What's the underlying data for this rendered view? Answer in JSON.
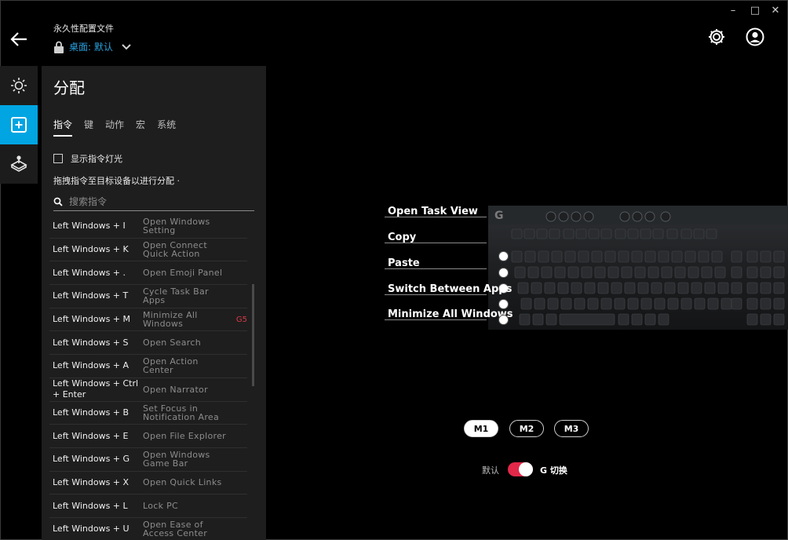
{
  "window_controls": {
    "minimize": "–",
    "maximize": "□",
    "close": "✕"
  },
  "header": {
    "profile_kind": "永久性配置文件",
    "profile_name": "桌面: 默认"
  },
  "panel": {
    "title": "分配",
    "tabs": [
      {
        "label": "指令",
        "active": true
      },
      {
        "label": "键",
        "active": false
      },
      {
        "label": "动作",
        "active": false
      },
      {
        "label": "宏",
        "active": false
      },
      {
        "label": "系统",
        "active": false
      }
    ],
    "show_lighting_label": "显示指令灯光",
    "show_lighting_checked": false,
    "drag_hint": "拖拽指令至目标设备以进行分配 ·",
    "search_placeholder": "搜索指令",
    "commands": [
      {
        "key": "Left Windows + I",
        "action": [
          "Open Windows",
          "Setting"
        ],
        "tag": ""
      },
      {
        "key": "Left Windows + K",
        "action": [
          "Open Connect",
          "Quick Action"
        ],
        "tag": ""
      },
      {
        "key": "Left Windows + .",
        "action": [
          "Open Emoji Panel"
        ],
        "tag": ""
      },
      {
        "key": "Left Windows + T",
        "action": [
          "Cycle Task Bar",
          "Apps"
        ],
        "tag": ""
      },
      {
        "key": "Left Windows + M",
        "action": [
          "Minimize All",
          "Windows"
        ],
        "tag": "G5"
      },
      {
        "key": "Left Windows + S",
        "action": [
          "Open Search"
        ],
        "tag": ""
      },
      {
        "key": "Left Windows + A",
        "action": [
          "Open Action",
          "Center"
        ],
        "tag": ""
      },
      {
        "key": "Left Windows + Ctrl + Enter",
        "action": [
          "Open Narrator"
        ],
        "tag": ""
      },
      {
        "key": "Left Windows + B",
        "action": [
          "Set Focus in",
          "Notification Area"
        ],
        "tag": ""
      },
      {
        "key": "Left Windows + E",
        "action": [
          "Open File Explorer"
        ],
        "tag": ""
      },
      {
        "key": "Left Windows + G",
        "action": [
          "Open Windows",
          "Game Bar"
        ],
        "tag": ""
      },
      {
        "key": "Left Windows + X",
        "action": [
          "Open Quick Links"
        ],
        "tag": ""
      },
      {
        "key": "Left Windows + L",
        "action": [
          "Lock PC"
        ],
        "tag": ""
      },
      {
        "key": "Left Windows + U",
        "action": [
          "Open Ease of",
          "Access Center"
        ],
        "tag": ""
      }
    ]
  },
  "keyboard": {
    "logo": "G",
    "assigned_commands": [
      "Open Task View",
      "Copy",
      "Paste",
      "Switch Between Apps",
      "Minimize All Windows"
    ]
  },
  "memory_slots": [
    {
      "label": "M1",
      "active": true
    },
    {
      "label": "M2",
      "active": false
    },
    {
      "label": "M3",
      "active": false
    }
  ],
  "toggle": {
    "left_label": "默认",
    "right_label": "G 切换",
    "on": true
  },
  "colors": {
    "accent_blue": "#00a5e2",
    "profile_blue": "#27a2e0",
    "toggle_red": "#e3284a",
    "gkey_red": "#d63a45"
  },
  "icons": [
    "back-arrow-icon",
    "lock-icon",
    "chevron-down-icon",
    "gear-icon",
    "account-icon",
    "lighting-icon",
    "assign-icon",
    "game-mode-icon",
    "search-icon"
  ]
}
